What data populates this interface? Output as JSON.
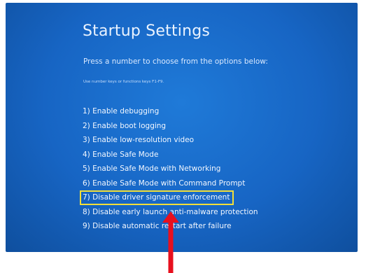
{
  "screen": {
    "title": "Startup Settings",
    "subtitle": "Press a number to choose from the options below:",
    "hint": "Use number keys or functions keys F1-F9.",
    "options": [
      {
        "label": "1) Enable debugging"
      },
      {
        "label": "2) Enable boot logging"
      },
      {
        "label": "3) Enable low-resolution video"
      },
      {
        "label": "4) Enable Safe Mode"
      },
      {
        "label": "5) Enable Safe Mode with Networking"
      },
      {
        "label": "6) Enable Safe Mode with Command Prompt"
      },
      {
        "label": "7) Disable driver signature enforcement",
        "highlighted": true
      },
      {
        "label": "8) Disable early launch anti-malware protection"
      },
      {
        "label": "9) Disable automatic restart after failure"
      }
    ]
  },
  "colors": {
    "background": "#1765c4",
    "highlight_box": "#f2df38",
    "arrow": "#e8101e"
  },
  "annotation": {
    "arrow_icon": "up-arrow-icon"
  }
}
